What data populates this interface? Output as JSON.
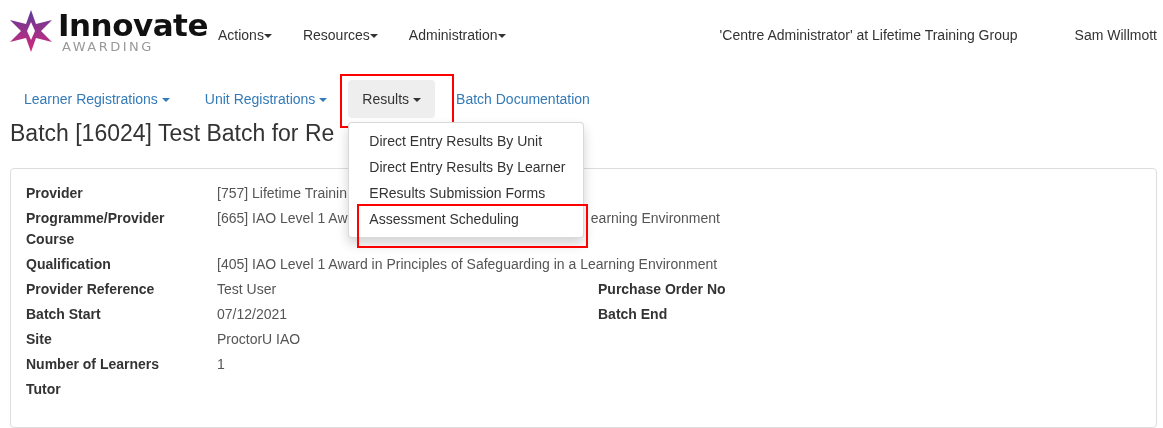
{
  "logo": {
    "name": "Innovate",
    "tagline": "AWARDING"
  },
  "top_menu": [
    {
      "label": "Actions"
    },
    {
      "label": "Resources"
    },
    {
      "label": "Administration"
    }
  ],
  "role": "'Centre Administrator' at Lifetime Training Group",
  "user": "Sam Willmott",
  "tabs": [
    {
      "label": "Learner Registrations",
      "dropdown": true,
      "selected": false,
      "highlighted": false
    },
    {
      "label": "Unit Registrations",
      "dropdown": true,
      "selected": false,
      "highlighted": false
    },
    {
      "label": "Results",
      "dropdown": true,
      "selected": true,
      "highlighted": true,
      "menu": [
        {
          "label": "Direct Entry Results By Unit",
          "highlighted": false
        },
        {
          "label": "Direct Entry Results By Learner",
          "highlighted": false
        },
        {
          "label": "EResults Submission Forms",
          "highlighted": false
        },
        {
          "label": "Assessment Scheduling",
          "highlighted": true
        }
      ]
    },
    {
      "label": "Batch Documentation",
      "dropdown": false,
      "selected": false,
      "highlighted": false
    }
  ],
  "page_title": "Batch [16024] Test Batch for Re",
  "details": [
    {
      "label": "Provider",
      "value": [
        "[757] Lifetime Trainin"
      ]
    },
    {
      "label": "Programme/Provider Course",
      "value": [
        "[665] IAO Level 1 Aw",
        "earning Environment"
      ]
    },
    {
      "label": "Qualification",
      "value": [
        "[405] IAO Level 1 Award in Principles of Safeguarding in a Learning Environment"
      ]
    },
    {
      "label": "Provider Reference",
      "value": [
        "Test User"
      ],
      "right_label": "Purchase Order No"
    },
    {
      "label": "Batch Start",
      "value": [
        "07/12/2021"
      ],
      "right_label": "Batch End"
    },
    {
      "label": "Site",
      "value": [
        "ProctorU IAO"
      ]
    },
    {
      "label": "Number of Learners",
      "value": [
        "1"
      ]
    },
    {
      "label": "Tutor"
    }
  ]
}
